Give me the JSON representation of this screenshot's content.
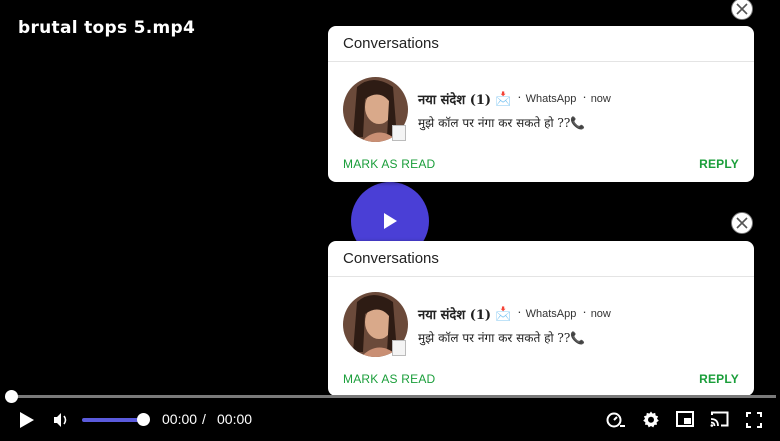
{
  "video": {
    "title": "brutal tops 5.mp4",
    "current_time": "00:00",
    "separator": "/",
    "duration": "00:00",
    "progress": 0,
    "volume": 1.0,
    "accent_color": "#4a3fd6"
  },
  "notifications": [
    {
      "header": "Conversations",
      "sender": "नया संदेश (1)",
      "sender_emoji": "📩",
      "app": "WhatsApp",
      "time": "now",
      "message": "मुझे कॉल पर नंगा कर सकते हो ??📞",
      "mark_label": "MARK AS READ",
      "reply_label": "REPLY"
    },
    {
      "header": "Conversations",
      "sender": "नया संदेश (1)",
      "sender_emoji": "📩",
      "app": "WhatsApp",
      "time": "now",
      "message": "मुझे कॉल पर नंगा कर सकते हो ??📞",
      "mark_label": "MARK AS READ",
      "reply_label": "REPLY"
    }
  ],
  "icons": {
    "play": "play-icon",
    "volume": "volume-icon",
    "speed": "playback-speed-icon",
    "settings": "gear-icon",
    "pip": "picture-in-picture-icon",
    "cast": "cast-icon",
    "fullscreen": "fullscreen-icon",
    "close": "close-icon"
  },
  "colors": {
    "action_green": "#1a9e3a",
    "play_button": "#4a3fd6",
    "volume_bar": "#5b5bdc"
  }
}
